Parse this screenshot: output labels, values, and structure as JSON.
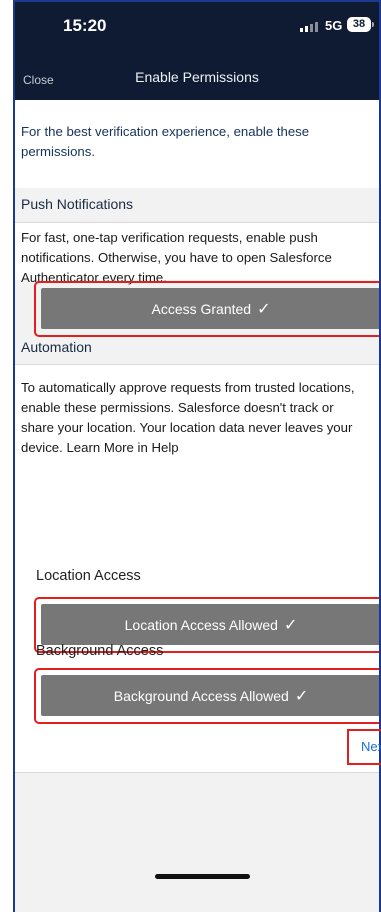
{
  "status_bar": {
    "time": "15:20",
    "network": "5G",
    "battery": "38"
  },
  "nav": {
    "close_label": "Close",
    "title": "Enable Permissions"
  },
  "intro": {
    "text": "For the best verification experience, enable these permissions."
  },
  "push": {
    "section_label": "Push Notifications",
    "description": "For fast, one-tap verification requests, enable push notifications. Otherwise, you have to open Salesforce Authenticator every time.",
    "button_label": "Access Granted"
  },
  "automation": {
    "section_label": "Automation",
    "description": "To automatically approve requests from trusted locations, enable these permissions. Salesforce doesn't track or share your location. Your location data never leaves your device. Learn More in Help",
    "location_label": "Location Access",
    "location_button": "Location Access Allowed",
    "background_label": "Background Access",
    "background_button": "Background Access Allowed"
  },
  "footer": {
    "next_label": "Next"
  },
  "icons": {
    "check": "checkmark-icon",
    "signal": "cellular-signal-icon",
    "battery": "battery-icon"
  },
  "colors": {
    "header_bg": "#0e1b33",
    "button_bg": "#777777",
    "highlight": "#e0201f",
    "link": "#1b6ed6"
  }
}
